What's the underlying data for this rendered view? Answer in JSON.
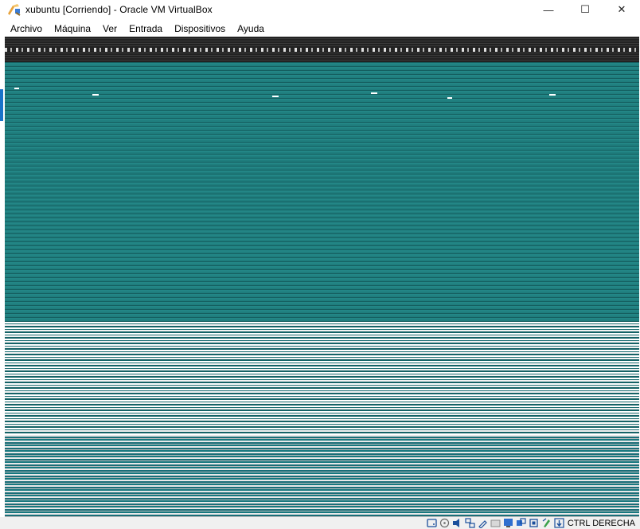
{
  "window": {
    "title": "xubuntu [Corriendo] - Oracle VM VirtualBox",
    "minimize_glyph": "—",
    "maximize_glyph": "☐",
    "close_glyph": "✕"
  },
  "menu": {
    "items": [
      "Archivo",
      "Máquina",
      "Ver",
      "Entrada",
      "Dispositivos",
      "Ayuda"
    ]
  },
  "status_bar": {
    "icons": [
      "hard-disk-icon",
      "optical-drive-icon",
      "audio-icon",
      "network-icon",
      "usb-icon",
      "shared-folders-icon",
      "display-icon",
      "video-capture-icon",
      "cpu-icon",
      "mouse-integration-icon",
      "keyboard-icon"
    ],
    "host_key_label": "CTRL DERECHA"
  },
  "colors": {
    "guest_teal": "#1f7d7d",
    "guest_topbar": "#222222",
    "accent_blue": "#1a73c9"
  }
}
